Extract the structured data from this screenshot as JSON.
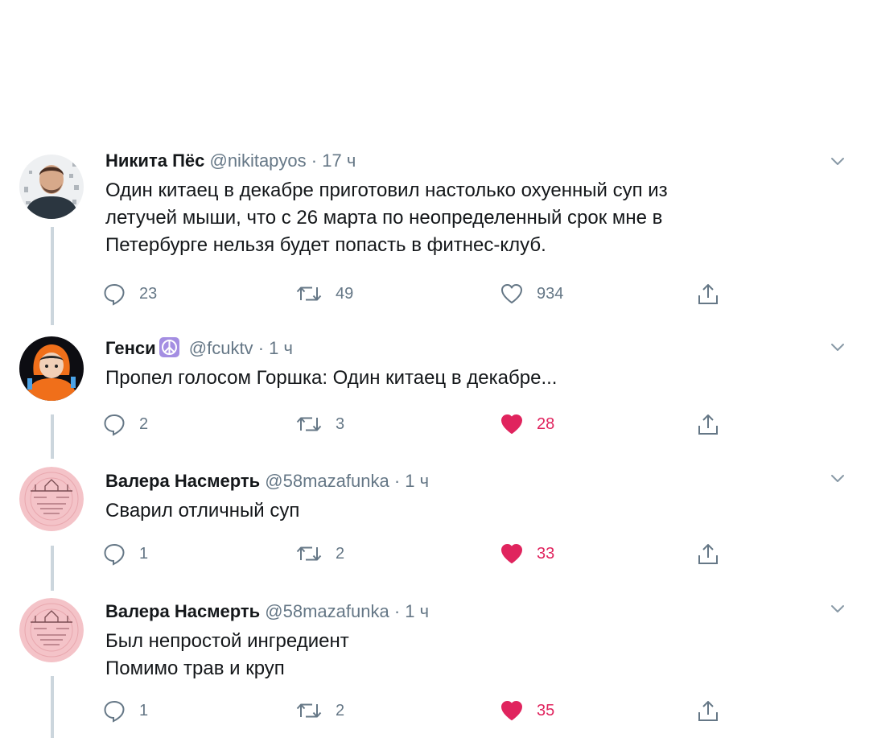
{
  "colors": {
    "text": "#14171a",
    "secondary": "#657786",
    "like_active": "#e0245e",
    "thread_line": "#ccd6dd"
  },
  "tweets": [
    {
      "author": "Никита Пёс",
      "handle": "@nikitapyos",
      "separator": "·",
      "time": "17 ч",
      "lines": [
        "Один китаец в декабре приготовил настолько охуенный суп из",
        "летучей мыши, что с 26 марта по неопределенный срок мне в",
        "Петербурге нельзя будет попасть в фитнес-клуб."
      ],
      "replies": "23",
      "retweets": "49",
      "likes": "934",
      "liked": false
    },
    {
      "author": "Генси",
      "badge_icon": "peace-symbol-icon",
      "handle": "@fcuktv",
      "separator": "·",
      "time": "1 ч",
      "lines": [
        "Пропел голосом Горшка: Один китаец в декабре..."
      ],
      "replies": "2",
      "retweets": "3",
      "likes": "28",
      "liked": true
    },
    {
      "author": "Валера Насмерть",
      "handle": "@58mazafunka",
      "separator": "·",
      "time": "1 ч",
      "lines": [
        "Сварил отличный суп"
      ],
      "replies": "1",
      "retweets": "2",
      "likes": "33",
      "liked": true
    },
    {
      "author": "Валера Насмерть",
      "handle": "@58mazafunka",
      "separator": "·",
      "time": "1 ч",
      "lines": [
        "Был непростой ингредиент",
        "Помимо трав и круп"
      ],
      "replies": "1",
      "retweets": "2",
      "likes": "35",
      "liked": true
    }
  ]
}
